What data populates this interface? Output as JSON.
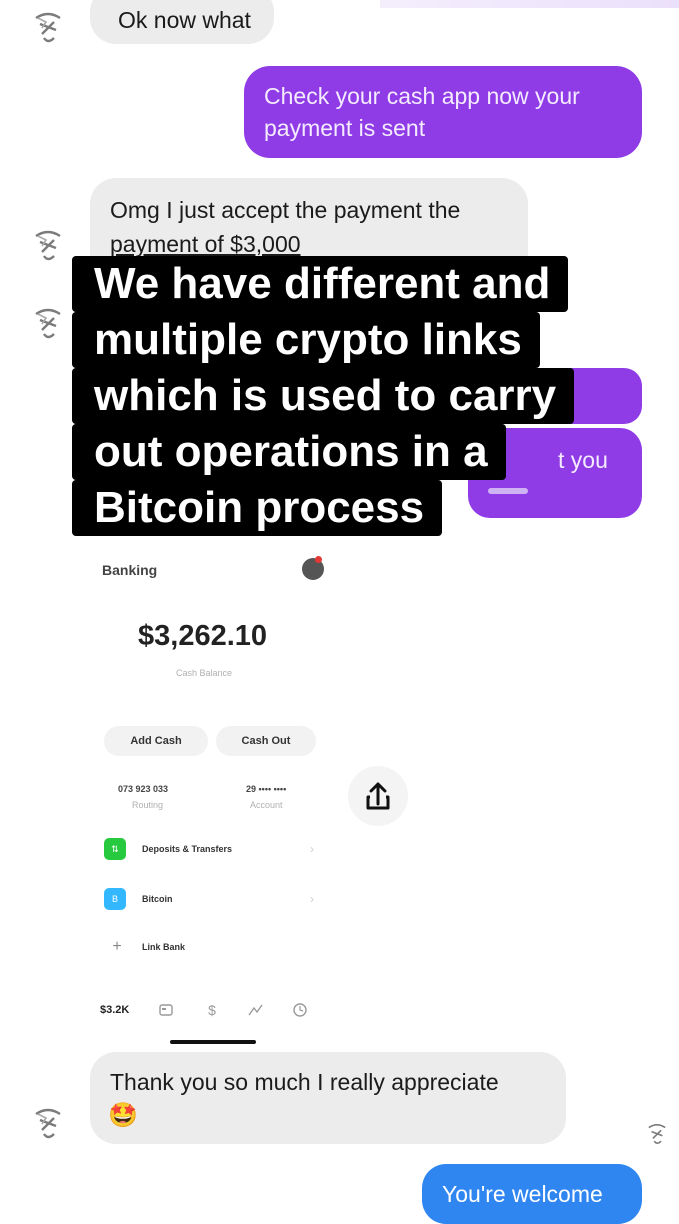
{
  "messages": {
    "m1": "Ok now what",
    "m2": "Check your cash app now your payment is sent",
    "m3_line1": "Omg I just accept the payment the",
    "m3_line2": "payment of $3,000",
    "m4_partial": "t you",
    "m5_line1": "Thank you so much I really appreciate",
    "m5_emoji": "🤩",
    "m6": "You're welcome"
  },
  "overlay": {
    "line1": "We have different and",
    "line2": "multiple crypto links",
    "line3": "which is used to carry",
    "line4": "out operations in a",
    "line5": "Bitcoin process"
  },
  "cash_app": {
    "section": "Banking",
    "balance": "$3,262.10",
    "balance_caption": "Cash Balance",
    "add_cash": "Add Cash",
    "cash_out": "Cash Out",
    "routing_number": "073 923 033",
    "routing_label": "Routing",
    "account_number": "29 •••• ••••",
    "account_label": "Account",
    "menu": [
      {
        "label": "Deposits & Transfers",
        "icon_color": "#27c93f"
      },
      {
        "label": "Bitcoin",
        "icon_color": "#33b8ff"
      },
      {
        "label": "Link Bank",
        "icon_color": "#ffffff"
      }
    ],
    "tab_balance": "$3.2K"
  },
  "colors": {
    "outgoing_bubble": "#8f3ce6",
    "incoming_bubble": "#ececec",
    "cash_green": "#27c93f",
    "bitcoin_blue": "#33b8ff"
  }
}
